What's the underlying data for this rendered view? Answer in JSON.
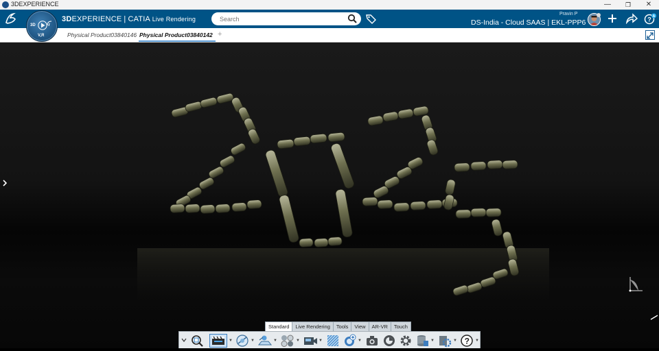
{
  "window": {
    "title": "3DEXPERIENCE",
    "controls": [
      "—",
      "❐",
      "✕"
    ]
  },
  "topbar": {
    "brand_bold": "3D",
    "brand_rest": "EXPERIENCE",
    "brand_sep": "|",
    "brand_app": "CATIA",
    "brand_role": "Live Rendering",
    "search_placeholder": "Search",
    "user_name": "Pravin P",
    "tenant": "DS-India - Cloud SAAS | EKL-PPP6",
    "compass_top": "3D",
    "compass_bottom": "V,R"
  },
  "tabs": [
    {
      "label": "Physical Product03840146",
      "active": false
    },
    {
      "label": "Physical Product03840142",
      "active": true
    }
  ],
  "tab_add": "+",
  "scene": {
    "model_text": "2025",
    "background": "#151515",
    "brick_color": "#8a8b6a"
  },
  "section_tabs": [
    "Standard",
    "Live Rendering",
    "Tools",
    "View",
    "AR-VR",
    "Touch"
  ],
  "active_section": "Standard",
  "action_icons": [
    "fit-all-icon",
    "render-settings-icon",
    "environment-icon",
    "lights-icon",
    "multiple-objects-icon",
    "camera-view-icon",
    "pattern-icon",
    "add-object-icon",
    "capture-image-icon",
    "render-preview-icon",
    "settings-gear-icon",
    "database-icon",
    "tools-options-icon",
    "help-icon"
  ],
  "colors": {
    "topbar": "#005386",
    "accent": "#5b9bd5"
  }
}
